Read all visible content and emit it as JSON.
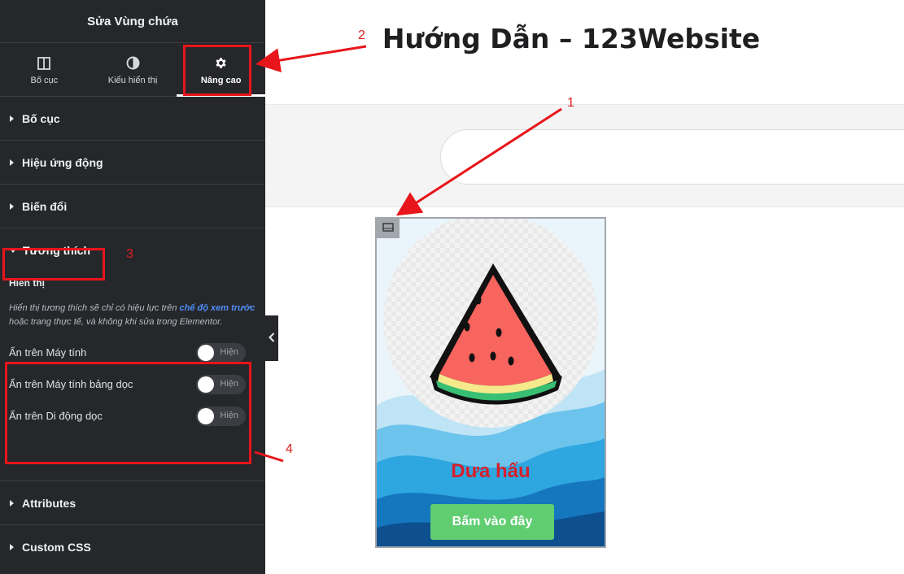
{
  "sidebar": {
    "title": "Sửa Vùng chứa",
    "tabs": [
      {
        "label": "Bố cục",
        "icon": "columns-icon"
      },
      {
        "label": "Kiểu hiển thị",
        "icon": "contrast-icon"
      },
      {
        "label": "Nâng cao",
        "icon": "gear-icon",
        "active": true
      }
    ],
    "sections": {
      "layout": "Bố cục",
      "motion": "Hiệu ứng động",
      "transform": "Biến đổi",
      "responsive": "Tương thích",
      "attributes": "Attributes",
      "custom_css": "Custom CSS"
    },
    "responsive": {
      "heading": "Hiển thị",
      "note_before": "Hiển thị tương thích sẽ chỉ có hiệu lực trên ",
      "note_link": "chế độ xem trước",
      "note_after": " hoặc trang thực tế, và không khi sửa trong Elementor.",
      "toggles": [
        {
          "label": "Ẩn trên Máy tính",
          "state": "Hiện"
        },
        {
          "label": "Ẩn trên Máy tính bảng dọc",
          "state": "Hiện"
        },
        {
          "label": "Ẩn trên Di động dọc",
          "state": "Hiện"
        }
      ]
    },
    "collapse_icon": "chevron-left-icon"
  },
  "canvas": {
    "page_title": "Hướng Dẫn – 123Website",
    "card": {
      "title": "Dưa hấu",
      "button": "Bấm vào đây",
      "handle_icon": "container-icon"
    }
  },
  "annotations": {
    "n1": "1",
    "n2": "2",
    "n3": "3",
    "n4": "4"
  },
  "colors": {
    "sidebar_bg": "#26272b",
    "highlight": "#e8151a",
    "card_title": "#d5202a",
    "card_button": "#60cd71",
    "link": "#4f8ef7"
  }
}
